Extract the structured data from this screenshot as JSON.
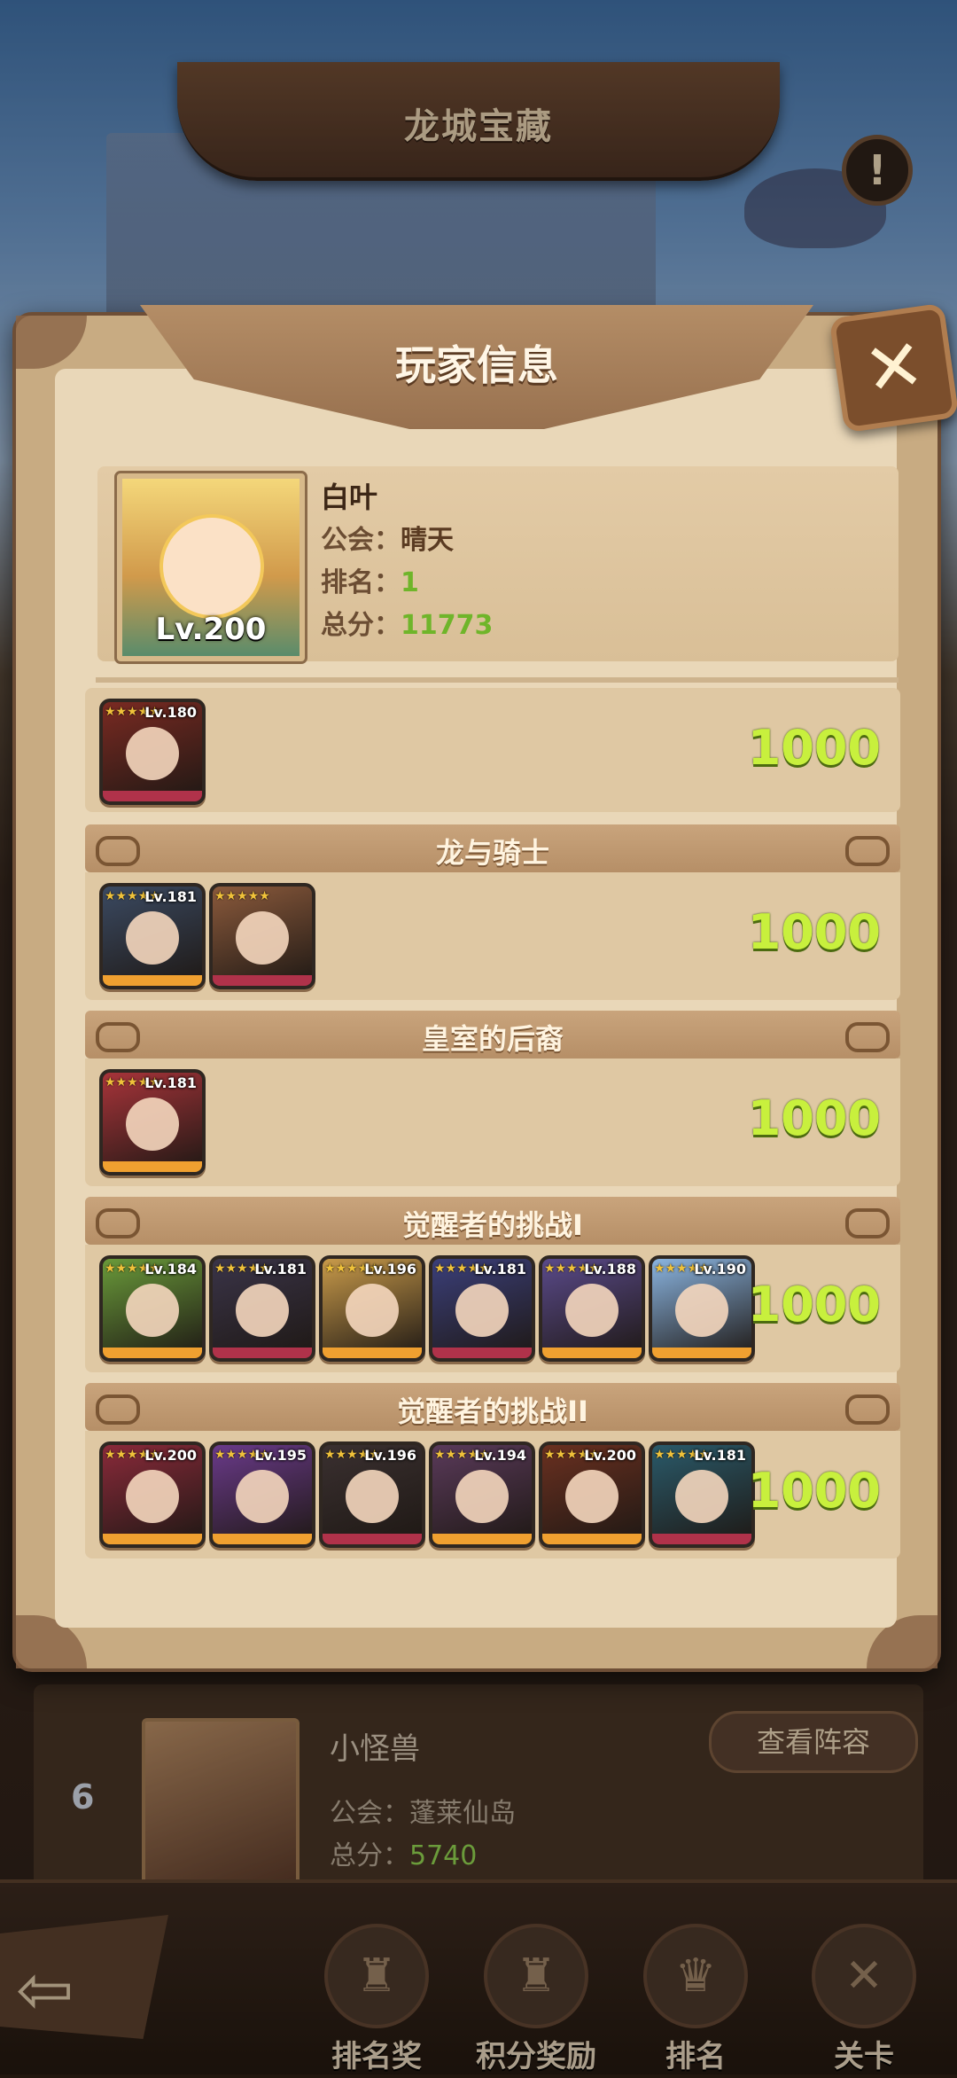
{
  "page": {
    "title": "龙城宝藏",
    "info_icon": "exclamation-icon"
  },
  "background_list": {
    "rank": "6",
    "name": "小怪兽",
    "guild_label": "公会：",
    "guild": "蓬莱仙岛",
    "score_label": "总分：",
    "score": "5740",
    "view_button": "查看阵容"
  },
  "nav": {
    "back_icon": "back-arrow-icon",
    "items": [
      {
        "label": "排名奖",
        "icon": "trophy-icon"
      },
      {
        "label": "积分奖励",
        "icon": "reward-icon"
      },
      {
        "label": "排名",
        "icon": "ranking-icon"
      },
      {
        "label": "关卡",
        "icon": "stage-icon"
      }
    ]
  },
  "modal": {
    "title": "玩家信息",
    "close_icon": "close-icon",
    "player": {
      "name": "白叶",
      "portrait_level": "Lv.200",
      "guild_label": "公会：",
      "guild": "晴天",
      "rank_label": "排名：",
      "rank": "1",
      "score_label": "总分：",
      "score": "11773"
    },
    "sections": [
      {
        "title": "",
        "score": "1000",
        "heroes": [
          {
            "level": "Lv.180",
            "stars": 5,
            "color": "#7a2a22",
            "rarity": "#b0324a"
          }
        ]
      },
      {
        "title": "龙与骑士",
        "score": "1000",
        "heroes": [
          {
            "level": "Lv.181",
            "stars": 5,
            "color": "#3b4a62",
            "rarity": "#f0a030"
          },
          {
            "level": "",
            "stars": 5,
            "color": "#8b5a3c",
            "rarity": "#b0324a"
          }
        ]
      },
      {
        "title": "皇室的后裔",
        "score": "1000",
        "heroes": [
          {
            "level": "Lv.181",
            "stars": 5,
            "color": "#a8343a",
            "rarity": "#f0a030"
          }
        ]
      },
      {
        "title": "觉醒者的挑战I",
        "score": "1000",
        "heroes": [
          {
            "level": "Lv.184",
            "stars": 5,
            "color": "#6a9a3a",
            "rarity": "#f0a030"
          },
          {
            "level": "Lv.181",
            "stars": 5,
            "color": "#3a3448",
            "rarity": "#b0324a"
          },
          {
            "level": "Lv.196",
            "stars": 5,
            "color": "#c89a4a",
            "rarity": "#f0a030"
          },
          {
            "level": "Lv.181",
            "stars": 5,
            "color": "#3b3f7a",
            "rarity": "#b0324a"
          },
          {
            "level": "Lv.188",
            "stars": 5,
            "color": "#5a4a8a",
            "rarity": "#f0a030"
          },
          {
            "level": "Lv.190",
            "stars": 5,
            "color": "#8ab4e0",
            "rarity": "#f0a030"
          }
        ]
      },
      {
        "title": "觉醒者的挑战II",
        "score": "1000",
        "heroes": [
          {
            "level": "Lv.200",
            "stars": 5,
            "color": "#8a2a3a",
            "rarity": "#f0a030"
          },
          {
            "level": "Lv.195",
            "stars": 5,
            "color": "#6a3a8a",
            "rarity": "#f0a030"
          },
          {
            "level": "Lv.196",
            "stars": 5,
            "color": "#3a3030",
            "rarity": "#b0324a"
          },
          {
            "level": "Lv.194",
            "stars": 5,
            "color": "#5a3a5a",
            "rarity": "#f0a030"
          },
          {
            "level": "Lv.200",
            "stars": 5,
            "color": "#6a3020",
            "rarity": "#f0a030"
          },
          {
            "level": "Lv.181",
            "stars": 5,
            "color": "#2a5a6a",
            "rarity": "#b0324a"
          }
        ]
      }
    ]
  }
}
